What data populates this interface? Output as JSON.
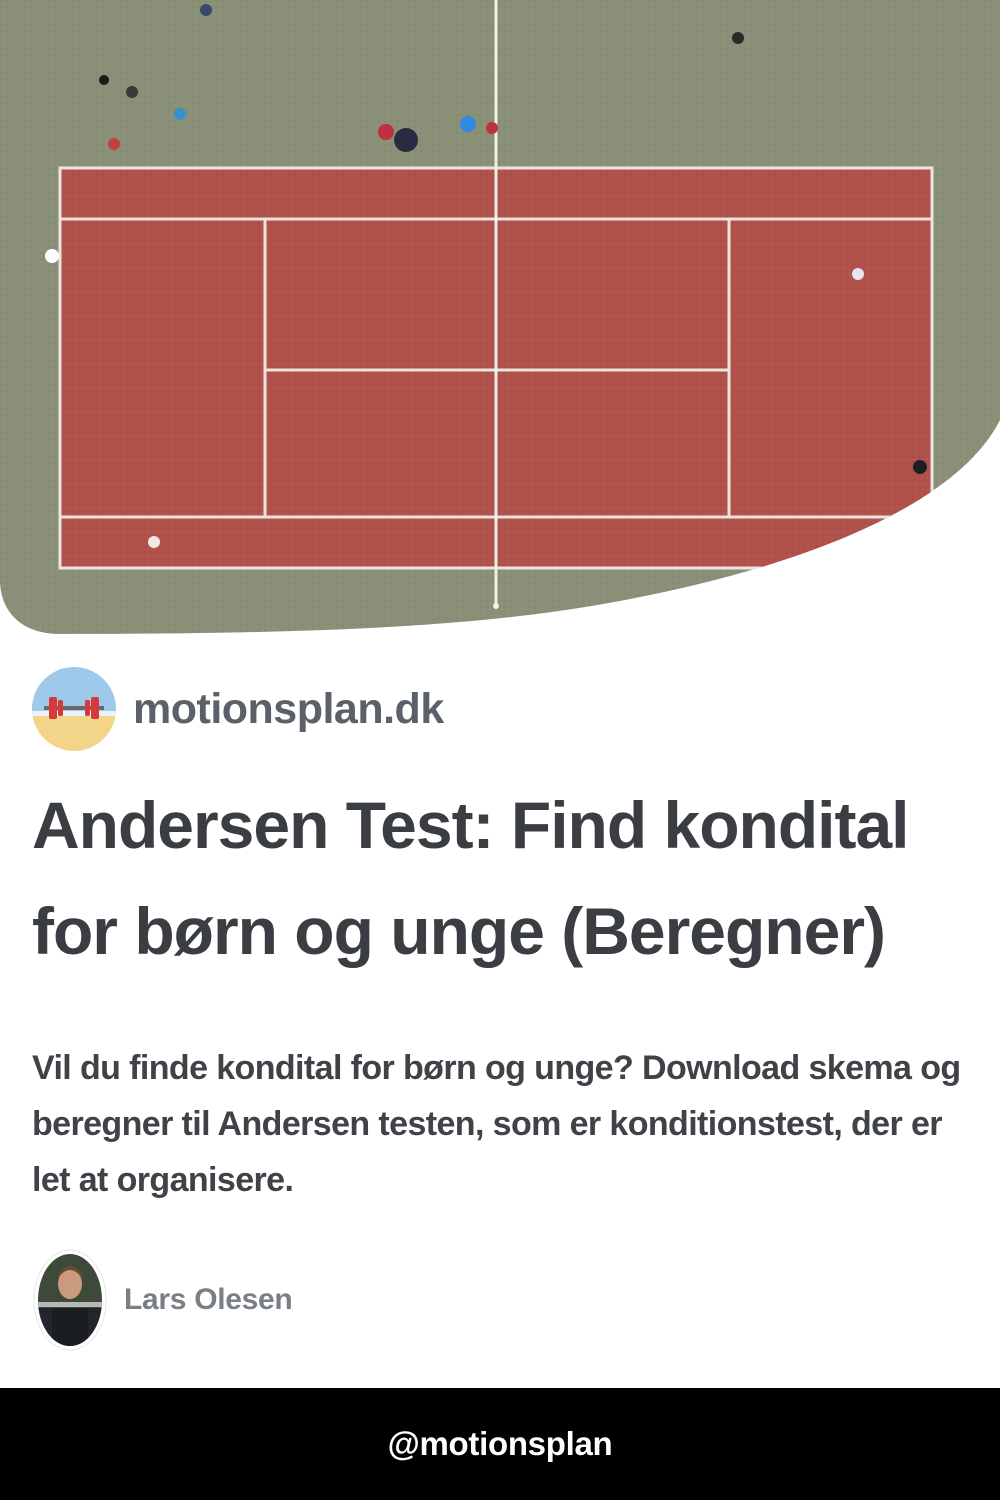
{
  "hero": {
    "image": "tennis-court-aerial-photo",
    "colors": {
      "surround": "#8a9078",
      "court": "#b0524b",
      "lines": "#ebe6dc"
    }
  },
  "site": {
    "logo_icon": "barbell-beach-icon",
    "name": "motionsplan.dk"
  },
  "article": {
    "title": "Andersen Test: Find kondital for børn og unge (Beregner)",
    "description": "Vil du finde kondital for børn og unge? Download skema og beregner til Andersen testen, som er konditionstest, der er let at organisere."
  },
  "author": {
    "avatar_icon": "author-photo",
    "name": "Lars Olesen"
  },
  "footer": {
    "handle": "@motionsplan"
  }
}
